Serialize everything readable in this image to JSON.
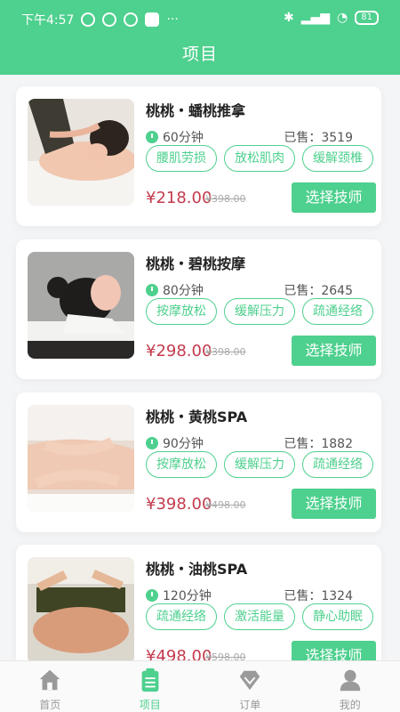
{
  "statusbar": {
    "time": "下午4:57",
    "battery": "81"
  },
  "page": {
    "title": "项目"
  },
  "projects": [
    {
      "name": "桃桃・蟠桃推拿",
      "duration": "60分钟",
      "sold": "已售：3519",
      "tags": [
        "腰肌劳损",
        "放松肌肉",
        "缓解颈椎"
      ],
      "price": "¥218.00",
      "original_price": "¥398.00",
      "action": "选择技师"
    },
    {
      "name": "桃桃・碧桃按摩",
      "duration": "80分钟",
      "sold": "已售：2645",
      "tags": [
        "按摩放松",
        "缓解压力",
        "疏通经络"
      ],
      "price": "¥298.00",
      "original_price": "¥398.00",
      "action": "选择技师"
    },
    {
      "name": "桃桃・黄桃SPA",
      "duration": "90分钟",
      "sold": "已售：1882",
      "tags": [
        "按摩放松",
        "缓解压力",
        "疏通经络"
      ],
      "price": "¥398.00",
      "original_price": "¥498.00",
      "action": "选择技师"
    },
    {
      "name": "桃桃・油桃SPA",
      "duration": "120分钟",
      "sold": "已售：1324",
      "tags": [
        "疏通经络",
        "激活能量",
        "静心助眠"
      ],
      "price": "¥498.00",
      "original_price": "¥598.00",
      "action": "选择技师"
    }
  ],
  "tabbar": {
    "items": [
      {
        "label": "首页",
        "icon": "home-icon",
        "active": false
      },
      {
        "label": "项目",
        "icon": "clipboard-icon",
        "active": true
      },
      {
        "label": "订单",
        "icon": "diamond-icon",
        "active": false
      },
      {
        "label": "我的",
        "icon": "user-icon",
        "active": false
      }
    ]
  },
  "colors": {
    "brand": "#4ed08e",
    "price": "#c33b4d"
  }
}
